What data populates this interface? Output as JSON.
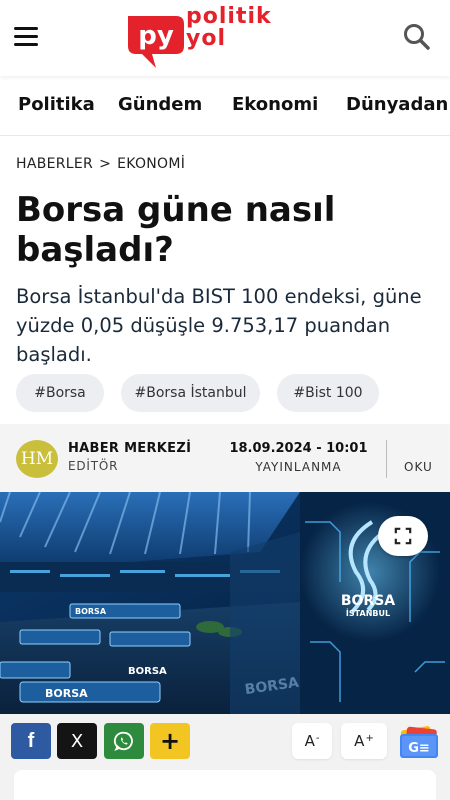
{
  "header": {
    "logo_line1": "politik",
    "logo_line2": "yol",
    "logo_mark": "py",
    "brand_color": "#e3222b",
    "menu_icon": "hamburger-icon",
    "search_icon": "search-icon"
  },
  "nav": {
    "items": [
      "Politika",
      "Gündem",
      "Ekonomi",
      "Dünyadan"
    ]
  },
  "breadcrumb": {
    "root": "HABERLER",
    "separator": ">",
    "current": "EKONOMİ"
  },
  "article": {
    "title": "Borsa güne nasıl başladı?",
    "summary": "Borsa İstanbul'da BIST 100 endeksi, güne yüzde 0,05 düşüşle 9.753,17 puandan başladı.",
    "tags": [
      "#Borsa",
      "#Borsa İstanbul",
      "#Bist 100"
    ]
  },
  "author": {
    "initials": "HM",
    "name": "HABER MERKEZİ",
    "role": "EDİTÖR",
    "date": "18.09.2024 - 10:01",
    "date_label": "YAYINLANMA",
    "read_label": "OKU"
  },
  "hero": {
    "sign_top": "BORSA",
    "sign_bottom": "İSTANBUL",
    "expand_icon": "expand-icon"
  },
  "share": {
    "facebook": "f",
    "x": "X",
    "whatsapp": "whatsapp-icon",
    "more": "+",
    "font_decrease": "A",
    "font_decrease_sign": "-",
    "font_increase": "A",
    "font_increase_sign": "+",
    "google_news": "G≡",
    "colors": {
      "facebook": "#2d5aa0",
      "x": "#141414",
      "whatsapp": "#2e8b3e",
      "more": "#f3c523"
    }
  }
}
